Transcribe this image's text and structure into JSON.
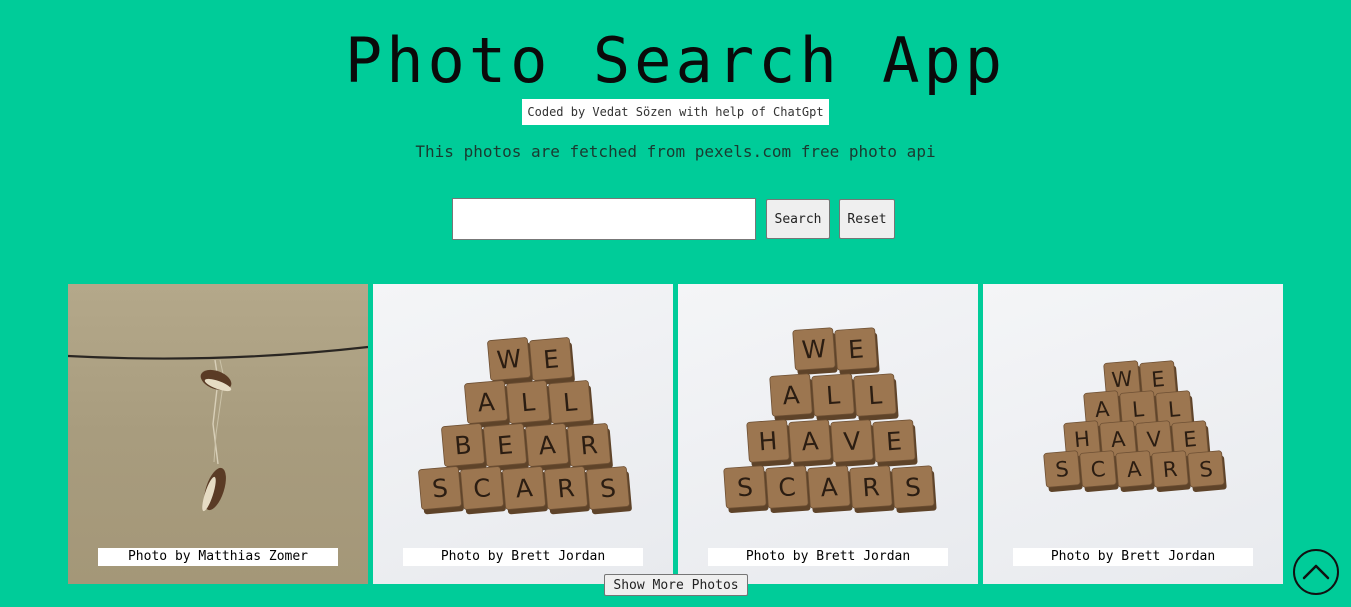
{
  "header": {
    "title": "Photo Search App",
    "credit": "Coded by Vedat Sözen with help of ChatGpt",
    "subtitle": "This photos are fetched from pexels.com free photo api"
  },
  "search": {
    "value": "",
    "placeholder": "",
    "search_label": "Search",
    "reset_label": "Reset"
  },
  "photos": [
    {
      "caption": "Photo by Matthias Zomer",
      "tiles": []
    },
    {
      "caption": "Photo by Brett Jordan",
      "tiles": [
        [
          "W",
          "E"
        ],
        [
          "A",
          "L",
          "L"
        ],
        [
          "B",
          "E",
          "A",
          "R"
        ],
        [
          "S",
          "C",
          "A",
          "R",
          "S"
        ]
      ]
    },
    {
      "caption": "Photo by Brett Jordan",
      "tiles": [
        [
          "W",
          "E"
        ],
        [
          "A",
          "L",
          "L"
        ],
        [
          "H",
          "A",
          "V",
          "E"
        ],
        [
          "S",
          "C",
          "A",
          "R",
          "S"
        ]
      ]
    },
    {
      "caption": "Photo by Brett Jordan",
      "tiles": [
        [
          "W",
          "E"
        ],
        [
          "A",
          "L",
          "L"
        ],
        [
          "H",
          "A",
          "V",
          "E"
        ],
        [
          "S",
          "C",
          "A",
          "R",
          "S"
        ]
      ]
    }
  ],
  "show_more_label": "Show More Photos",
  "scroll_top_icon": "chevron-up-circle-icon",
  "colors": {
    "background": "#00cc99",
    "tile": "#9c7650"
  }
}
